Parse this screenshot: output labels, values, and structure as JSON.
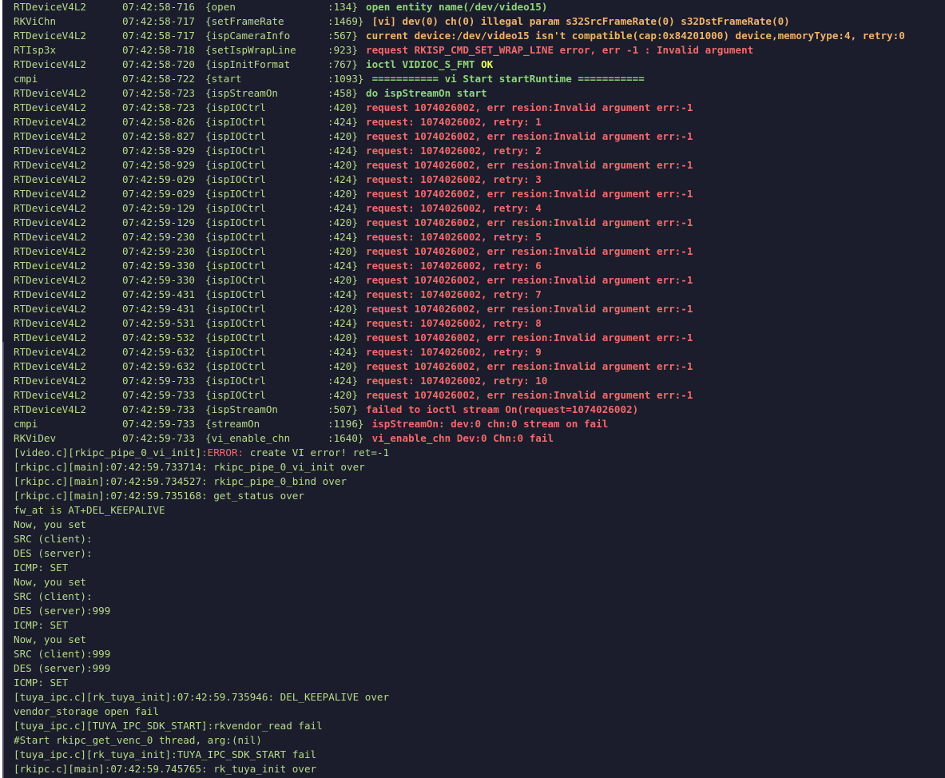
{
  "log_rows": [
    {
      "tag": "RTDeviceV4L2",
      "time": "07:42:58-716",
      "func": "{open",
      "line": ":134}",
      "msg": "open entity name(/dev/video15)",
      "level": "info"
    },
    {
      "tag": "RKViChn",
      "time": "07:42:58-717",
      "func": "{setFrameRate",
      "line": ":1469}",
      "msg": " [vi] dev(0) ch(0) illegal param s32SrcFrameRate(0) s32DstFrameRate(0)",
      "level": "warn"
    },
    {
      "tag": "RTDeviceV4L2",
      "time": "07:42:58-717",
      "func": "{ispCameraInfo",
      "line": ":567}",
      "msg": "current device:/dev/video15 isn't compatible(cap:0x84201000) device,memoryType:4, retry:0",
      "level": "warn"
    },
    {
      "tag": "RTIsp3x",
      "time": "07:42:58-718",
      "func": "{setIspWrapLine",
      "line": ":923}",
      "msg": "request RKISP_CMD_SET_WRAP_LINE error, err -1 : Invalid argument",
      "level": "error"
    },
    {
      "tag": "RTDeviceV4L2",
      "time": "07:42:58-720",
      "func": "{ispInitFormat",
      "line": ":767}",
      "msg": "ioctl VIDIOC_S_FMT ",
      "msg_ok": "OK",
      "level": "info"
    },
    {
      "tag": "cmpi",
      "time": "07:42:58-722",
      "func": "{start",
      "line": ":1093}",
      "msg": " =========== vi Start startRuntime ===========",
      "level": "info"
    },
    {
      "tag": "RTDeviceV4L2",
      "time": "07:42:58-723",
      "func": "{ispStreamOn",
      "line": ":458}",
      "msg": "do ispStreamOn start",
      "level": "info"
    },
    {
      "tag": "RTDeviceV4L2",
      "time": "07:42:58-723",
      "func": "{ispIOCtrl",
      "line": ":420}",
      "msg": "request 1074026002, err resion:Invalid argument err:-1",
      "level": "error"
    },
    {
      "tag": "RTDeviceV4L2",
      "time": "07:42:58-826",
      "func": "{ispIOCtrl",
      "line": ":424}",
      "msg": "request: 1074026002, retry: 1",
      "level": "error"
    },
    {
      "tag": "RTDeviceV4L2",
      "time": "07:42:58-827",
      "func": "{ispIOCtrl",
      "line": ":420}",
      "msg": "request 1074026002, err resion:Invalid argument err:-1",
      "level": "error"
    },
    {
      "tag": "RTDeviceV4L2",
      "time": "07:42:58-929",
      "func": "{ispIOCtrl",
      "line": ":424}",
      "msg": "request: 1074026002, retry: 2",
      "level": "error"
    },
    {
      "tag": "RTDeviceV4L2",
      "time": "07:42:58-929",
      "func": "{ispIOCtrl",
      "line": ":420}",
      "msg": "request 1074026002, err resion:Invalid argument err:-1",
      "level": "error"
    },
    {
      "tag": "RTDeviceV4L2",
      "time": "07:42:59-029",
      "func": "{ispIOCtrl",
      "line": ":424}",
      "msg": "request: 1074026002, retry: 3",
      "level": "error"
    },
    {
      "tag": "RTDeviceV4L2",
      "time": "07:42:59-029",
      "func": "{ispIOCtrl",
      "line": ":420}",
      "msg": "request 1074026002, err resion:Invalid argument err:-1",
      "level": "error"
    },
    {
      "tag": "RTDeviceV4L2",
      "time": "07:42:59-129",
      "func": "{ispIOCtrl",
      "line": ":424}",
      "msg": "request: 1074026002, retry: 4",
      "level": "error"
    },
    {
      "tag": "RTDeviceV4L2",
      "time": "07:42:59-129",
      "func": "{ispIOCtrl",
      "line": ":420}",
      "msg": "request 1074026002, err resion:Invalid argument err:-1",
      "level": "error"
    },
    {
      "tag": "RTDeviceV4L2",
      "time": "07:42:59-230",
      "func": "{ispIOCtrl",
      "line": ":424}",
      "msg": "request: 1074026002, retry: 5",
      "level": "error"
    },
    {
      "tag": "RTDeviceV4L2",
      "time": "07:42:59-230",
      "func": "{ispIOCtrl",
      "line": ":420}",
      "msg": "request 1074026002, err resion:Invalid argument err:-1",
      "level": "error"
    },
    {
      "tag": "RTDeviceV4L2",
      "time": "07:42:59-330",
      "func": "{ispIOCtrl",
      "line": ":424}",
      "msg": "request: 1074026002, retry: 6",
      "level": "error"
    },
    {
      "tag": "RTDeviceV4L2",
      "time": "07:42:59-330",
      "func": "{ispIOCtrl",
      "line": ":420}",
      "msg": "request 1074026002, err resion:Invalid argument err:-1",
      "level": "error"
    },
    {
      "tag": "RTDeviceV4L2",
      "time": "07:42:59-431",
      "func": "{ispIOCtrl",
      "line": ":424}",
      "msg": "request: 1074026002, retry: 7",
      "level": "error"
    },
    {
      "tag": "RTDeviceV4L2",
      "time": "07:42:59-431",
      "func": "{ispIOCtrl",
      "line": ":420}",
      "msg": "request 1074026002, err resion:Invalid argument err:-1",
      "level": "error"
    },
    {
      "tag": "RTDeviceV4L2",
      "time": "07:42:59-531",
      "func": "{ispIOCtrl",
      "line": ":424}",
      "msg": "request: 1074026002, retry: 8",
      "level": "error"
    },
    {
      "tag": "RTDeviceV4L2",
      "time": "07:42:59-532",
      "func": "{ispIOCtrl",
      "line": ":420}",
      "msg": "request 1074026002, err resion:Invalid argument err:-1",
      "level": "error"
    },
    {
      "tag": "RTDeviceV4L2",
      "time": "07:42:59-632",
      "func": "{ispIOCtrl",
      "line": ":424}",
      "msg": "request: 1074026002, retry: 9",
      "level": "error"
    },
    {
      "tag": "RTDeviceV4L2",
      "time": "07:42:59-632",
      "func": "{ispIOCtrl",
      "line": ":420}",
      "msg": "request 1074026002, err resion:Invalid argument err:-1",
      "level": "error"
    },
    {
      "tag": "RTDeviceV4L2",
      "time": "07:42:59-733",
      "func": "{ispIOCtrl",
      "line": ":424}",
      "msg": "request: 1074026002, retry: 10",
      "level": "error"
    },
    {
      "tag": "RTDeviceV4L2",
      "time": "07:42:59-733",
      "func": "{ispIOCtrl",
      "line": ":420}",
      "msg": "request 1074026002, err resion:Invalid argument err:-1",
      "level": "error"
    },
    {
      "tag": "RTDeviceV4L2",
      "time": "07:42:59-733",
      "func": "{ispStreamOn",
      "line": ":507}",
      "msg": "failed to ioctl stream On(request=1074026002)",
      "level": "error"
    },
    {
      "tag": "cmpi",
      "time": "07:42:59-733",
      "func": "{streamOn",
      "line": ":1196}",
      "msg": " ispStreamOn: dev:0 chn:0 stream on fail",
      "level": "error"
    },
    {
      "tag": "RKViDev",
      "time": "07:42:59-733",
      "func": "{vi_enable_chn",
      "line": ":1640}",
      "msg": " vi_enable_chn Dev:0 Chn:0 fail",
      "level": "error"
    }
  ],
  "error_line": {
    "prefix": "[video.c][rkipc_pipe_0_vi_init]",
    "error_word": ":ERROR:",
    "suffix": " create VI error! ret=-1"
  },
  "plain_lines": [
    "[rkipc.c][main]:07:42:59.733714: rkipc_pipe_0_vi_init over",
    "[rkipc.c][main]:07:42:59.734527: rkipc_pipe_0_bind over",
    "[rkipc.c][main]:07:42:59.735168: get_status over",
    "fw_at is AT+DEL_KEEPALIVE",
    "Now, you set",
    "SRC (client):",
    "DES (server):",
    "ICMP: SET",
    "Now, you set",
    "SRC (client):",
    "DES (server):999",
    "ICMP: SET",
    "Now, you set",
    "SRC (client):999",
    "DES (server):999",
    "ICMP: SET",
    "[tuya_ipc.c][rk_tuya_init]:07:42:59.735946: DEL_KEEPALIVE over",
    "vendor_storage open fail",
    "[tuya_ipc.c][TUYA_IPC_SDK_START]:rkvendor_read fail",
    "#Start rkipc_get_venc_0 thread, arg:(nil)",
    "[tuya_ipc.c][rk_tuya_init]:TUYA_IPC_SDK_START fail",
    "[rkipc.c][main]:07:42:59.745765: rk_tuya_init over"
  ]
}
